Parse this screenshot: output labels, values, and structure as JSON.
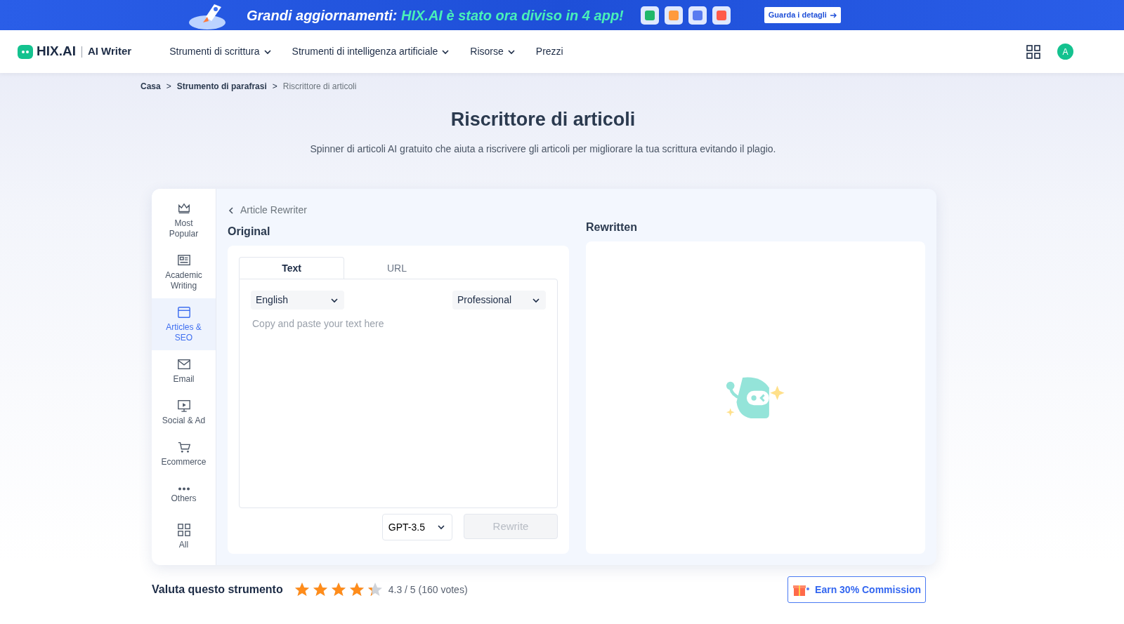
{
  "banner": {
    "headline_bold": "Grandi aggiornamenti:",
    "headline_accent": "HIX.AI è stato ora diviso in 4 app!",
    "button": "Guarda i detagli"
  },
  "navbar": {
    "brand": "HIX.AI",
    "product": "AI Writer",
    "menu": [
      {
        "label": "Strumenti di scrittura",
        "dropdown": true
      },
      {
        "label": "Strumenti di intelligenza artificiale",
        "dropdown": true
      },
      {
        "label": "Risorse",
        "dropdown": true
      },
      {
        "label": "Prezzi",
        "dropdown": false
      }
    ],
    "avatar": "A"
  },
  "breadcrumb": [
    {
      "label": "Casa",
      "current": false
    },
    {
      "label": "Strumento di parafrasi",
      "current": false
    },
    {
      "label": "Riscrittore di articoli",
      "current": true
    }
  ],
  "breadcrumb_separator": ">",
  "title": "Riscrittore di articoli",
  "subtitle": "Spinner di articoli AI gratuito che aiuta a riscrivere gli articoli per migliorare la tua scrittura evitando il plagio.",
  "sidebar": {
    "items": [
      {
        "label": "Most Popular",
        "kind": "crown",
        "selected": false
      },
      {
        "label": "Academic Writing",
        "kind": "newspaper",
        "selected": false
      },
      {
        "label": "Articles & SEO",
        "kind": "window",
        "selected": true
      },
      {
        "label": "Email",
        "kind": "mail",
        "selected": false
      },
      {
        "label": "Social & Ad",
        "kind": "monitor",
        "selected": false
      },
      {
        "label": "Ecommerce",
        "kind": "cart",
        "selected": false
      },
      {
        "label": "Others",
        "kind": "dots",
        "selected": false
      },
      {
        "label": "All",
        "kind": "grid",
        "selected": false
      }
    ]
  },
  "tool": {
    "back_label": "Article Rewriter",
    "original": {
      "heading": "Original",
      "tabs": [
        {
          "label": "Text",
          "selected": true
        },
        {
          "label": "URL",
          "selected": false
        }
      ],
      "language": "English",
      "tone": "Professional",
      "placeholder": "Copy and paste your text here",
      "model": "GPT-3.5",
      "rewrite_button": {
        "label": "Rewrite",
        "disabled": true
      }
    },
    "rewritten": {
      "heading": "Rewritten"
    }
  },
  "rating": {
    "label": "Valuta questo strumento",
    "stars": 4.3,
    "score": "4.3 / 5 (160 votes)"
  },
  "commission_button": "Earn 30% Commission"
}
